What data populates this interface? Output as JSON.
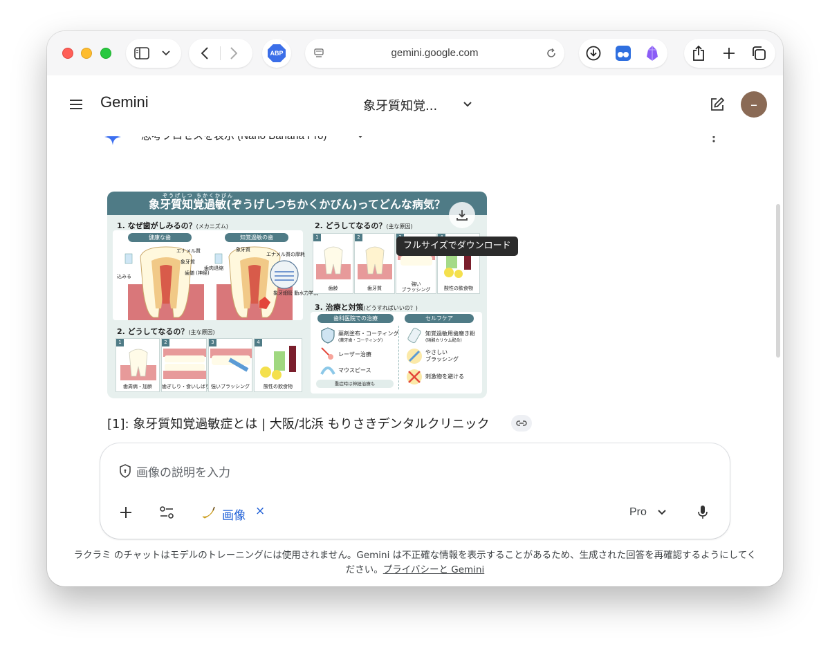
{
  "browser": {
    "url": "gemini.google.com",
    "abp_label": "ABP"
  },
  "app": {
    "title": "Gemini",
    "conversation_title": "象牙質知覚...",
    "avatar_initial": "–"
  },
  "thinking": {
    "label": "思考プロセスを表示 (Nano Banana Pro)"
  },
  "infographic": {
    "title": "象牙質知覚過敏(ぞうげしつちかくかびん)ってどんな病気？",
    "ruby": "ぞうげしつ ちかくかびん",
    "section1": {
      "heading": "1. なぜ歯がしみるの？",
      "heading_sub": "(メカニズム)",
      "healthy": "健康な歯",
      "sensitive": "知覚過敏の歯",
      "labels": {
        "enamel": "エナメル質",
        "dentin": "象牙質",
        "pulp": "歯髄\n(神経)",
        "soak": "込みる",
        "gum_recession": "歯肉退縮",
        "dentin2": "象牙質",
        "enamel_wear": "エナメル質の摩耗",
        "tubules": "象牙細管\n動水力学説"
      }
    },
    "section2_top": {
      "heading": "2. どうしてなるの？",
      "heading_sub": "(主な原因)",
      "items": [
        {
          "num": "1",
          "caption": "歯齢"
        },
        {
          "num": "2",
          "caption": "歯牙質"
        },
        {
          "num": "3",
          "caption": "強い\nブラッシング"
        },
        {
          "num": "4",
          "caption": "酸性の飲食物"
        }
      ]
    },
    "section2_bottom": {
      "heading": "2. どうしてなるの？",
      "heading_sub": "(主な原因)",
      "items": [
        {
          "num": "1",
          "caption": "歯周病・加齢"
        },
        {
          "num": "2",
          "caption": "歯ぎしり・食いしばり"
        },
        {
          "num": "3",
          "caption": "強いブラッシング"
        },
        {
          "num": "4",
          "caption": "酸性の飲食物"
        }
      ]
    },
    "section3": {
      "heading": "3. 治療と対策",
      "heading_sub": "(どうすればいいの？)",
      "clinic": "歯科医院での治療",
      "selfcare": "セルフケア",
      "clinic_items": [
        "薬剤塗布・コーティング",
        "レーザー治療",
        "マウスピース"
      ],
      "clinic_sub": "(薬牙歯・コーティング)",
      "clinic_note": "重症時は神経治療も",
      "selfcare_items": [
        "知覚過敏用歯磨き粉",
        "やさしい\nブラッシング",
        "刺激物を避ける"
      ],
      "selfcare_sub": "(硝酸カリウム配合)"
    }
  },
  "tooltip": "フルサイズでダウンロード",
  "citation": "[1]: 象牙質知覚過敏症とは | 大阪/北浜 もりさきデンタルクリニック",
  "input": {
    "placeholder": "画像の説明を入力",
    "chip_label": "画像",
    "chip_close": "×",
    "model": "Pro"
  },
  "disclaimer": {
    "text": "ラクラミ のチャットはモデルのトレーニングには使用されません。Gemini は不正確な情報を表示することがあるため、生成された回答を再確認するようにしてください。",
    "link": "プライバシーと Gemini"
  }
}
